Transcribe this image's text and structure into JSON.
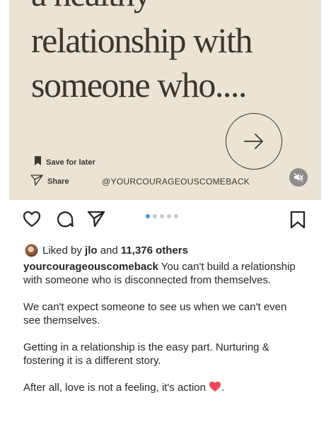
{
  "image": {
    "headline_lines": [
      "a healthy",
      "relationship with",
      "someone who...."
    ],
    "save_label": "Save for later",
    "share_label": "Share",
    "handle": "@YOURCOURAGEOUSCOMEBACK"
  },
  "carousel": {
    "total": 5,
    "current": 1
  },
  "likes": {
    "prefix": "Liked by",
    "user": "jlo",
    "and": "and",
    "count": "11,376 others"
  },
  "caption": {
    "username": "yourcourageouscomeback",
    "first": " You can't build a relationship with someone who is disconnected from themselves.",
    "p2": "We can't expect someone to see us when we can't even see themselves.",
    "p3": "Getting in a relationship is the easy part. Nurturing & fostering it is a different story.",
    "p4_text": "After all, love is not a feeling, it's action ",
    "p4_end": "."
  },
  "colors": {
    "image_bg": "#ebe3d3",
    "text": "#262626",
    "accent": "#3897f0",
    "heart": "#ed4956"
  }
}
